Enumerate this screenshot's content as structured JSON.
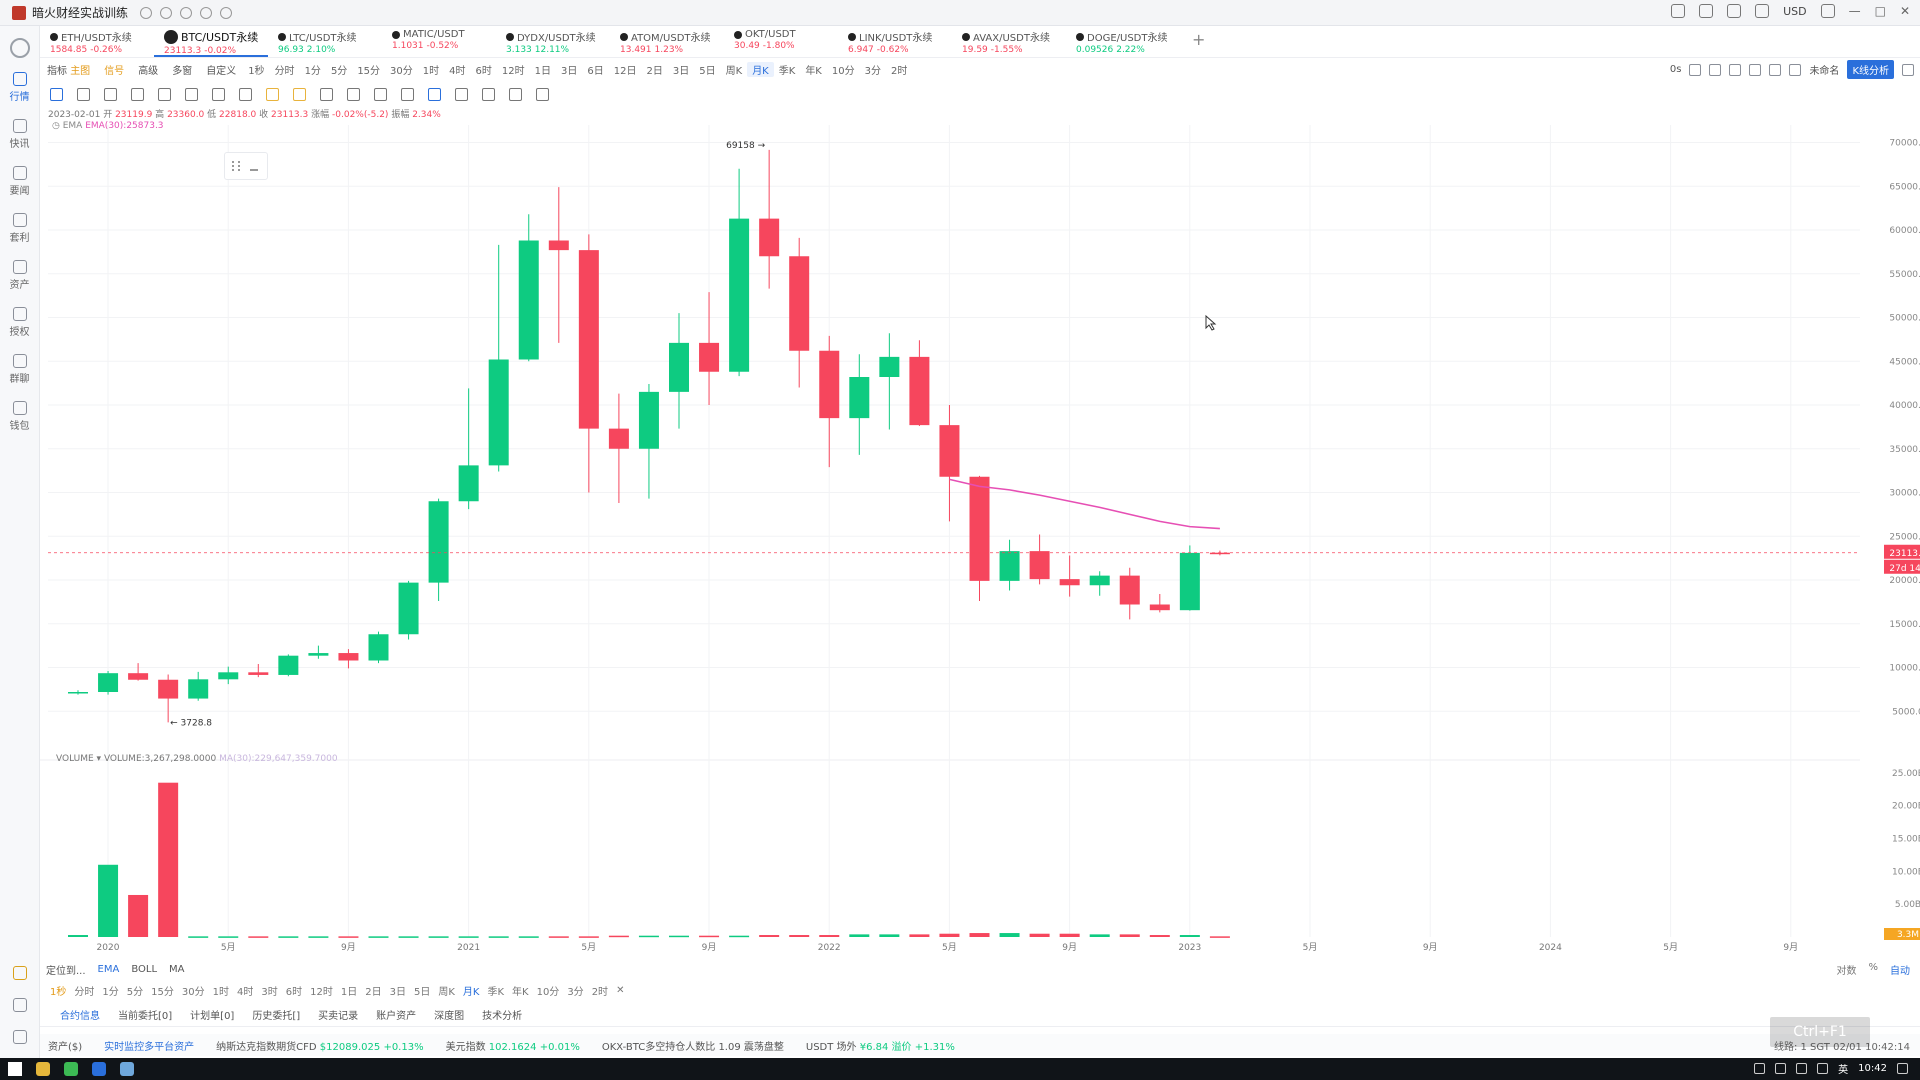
{
  "window": {
    "title": "暗火财经实战训练",
    "currency": "USD"
  },
  "sidebar": {
    "items": [
      {
        "label": "行情",
        "active": true,
        "icon": "market-icon"
      },
      {
        "label": "快讯",
        "active": false,
        "icon": "news-flash-icon"
      },
      {
        "label": "要闻",
        "active": false,
        "icon": "news-icon"
      },
      {
        "label": "套利",
        "active": false,
        "icon": "arbitrage-icon"
      },
      {
        "label": "资产",
        "active": false,
        "icon": "assets-icon"
      },
      {
        "label": "授权",
        "active": false,
        "icon": "auth-icon"
      },
      {
        "label": "群聊",
        "active": false,
        "icon": "chat-icon"
      },
      {
        "label": "钱包",
        "active": false,
        "icon": "wallet-icon"
      }
    ]
  },
  "tabs": [
    {
      "name": "ETH/USDT永续",
      "price": "1584.85",
      "change": "-0.26%",
      "dir": "down"
    },
    {
      "name": "BTC/USDT永续",
      "price": "23113.3",
      "change": "-0.02%",
      "dir": "down",
      "active": true
    },
    {
      "name": "LTC/USDT永续",
      "price": "96.93",
      "change": "2.10%",
      "dir": "up"
    },
    {
      "name": "MATIC/USDT",
      "price": "1.1031",
      "change": "-0.52%",
      "dir": "down"
    },
    {
      "name": "DYDX/USDT永续",
      "price": "3.133",
      "change": "12.11%",
      "dir": "up"
    },
    {
      "name": "ATOM/USDT永续",
      "price": "13.491",
      "change": "1.23%",
      "dir": "down"
    },
    {
      "name": "OKT/USDT",
      "price": "30.49",
      "change": "-1.80%",
      "dir": "down"
    },
    {
      "name": "LINK/USDT永续",
      "price": "6.947",
      "change": "-0.62%",
      "dir": "down"
    },
    {
      "name": "AVAX/USDT永续",
      "price": "19.59",
      "change": "-1.55%",
      "dir": "down"
    },
    {
      "name": "DOGE/USDT永续",
      "price": "0.09526",
      "change": "2.22%",
      "dir": "up"
    }
  ],
  "toolbar": {
    "indicator": "指标",
    "indicator_tag": "主图",
    "signal": "信号",
    "advanced": "高级",
    "multi": "多窗",
    "custom": "自定义",
    "timeframes": [
      "1秒",
      "分时",
      "1分",
      "5分",
      "15分",
      "30分",
      "1时",
      "4时",
      "6时",
      "12时",
      "1日",
      "3日",
      "6日",
      "12日",
      "2日",
      "3日",
      "5日",
      "周K",
      "月K",
      "季K",
      "年K",
      "10分",
      "3分",
      "2时"
    ],
    "selected_tf": "月K",
    "right_seconds": "0s",
    "user": "未命名",
    "kline_btn": "K线分析"
  },
  "ohlc": {
    "date": "2023-02-01",
    "open_l": "开",
    "open": "23119.9",
    "high_l": "高",
    "high": "23360.0",
    "low_l": "低",
    "low": "22818.0",
    "close_l": "收",
    "close": "23113.3",
    "chg_l": "涨幅",
    "chg": "-0.02%(-5.2)",
    "amp_l": "振幅",
    "amp": "2.34%"
  },
  "ema_legend": {
    "label": "EMA",
    "value": "EMA(30):25873.3"
  },
  "volume_header": {
    "label": "VOLUME",
    "value": "VOLUME:3,267,298.0000",
    "ma": "MA(30):229,647,359.7000"
  },
  "chart_data": {
    "type": "candlestick",
    "interval": "1M",
    "months": [
      "2019-12",
      "2020-01",
      "2020-02",
      "2020-03",
      "2020-04",
      "2020-05",
      "2020-06",
      "2020-07",
      "2020-08",
      "2020-09",
      "2020-10",
      "2020-11",
      "2020-12",
      "2021-01",
      "2021-02",
      "2021-03",
      "2021-04",
      "2021-05",
      "2021-06",
      "2021-07",
      "2021-08",
      "2021-09",
      "2021-10",
      "2021-11",
      "2021-12",
      "2022-01",
      "2022-02",
      "2022-03",
      "2022-04",
      "2022-05",
      "2022-06",
      "2022-07",
      "2022-08",
      "2022-09",
      "2022-10",
      "2022-11",
      "2022-12",
      "2023-01",
      "2023-02"
    ],
    "candles": [
      {
        "o": 7200,
        "h": 7400,
        "l": 6900,
        "c": 7200
      },
      {
        "o": 7200,
        "h": 9600,
        "l": 6900,
        "c": 9350
      },
      {
        "o": 9350,
        "h": 10500,
        "l": 8500,
        "c": 8600
      },
      {
        "o": 8600,
        "h": 9200,
        "l": 3728.8,
        "c": 6450
      },
      {
        "o": 6450,
        "h": 9500,
        "l": 6200,
        "c": 8650
      },
      {
        "o": 8650,
        "h": 10100,
        "l": 8100,
        "c": 9450
      },
      {
        "o": 9450,
        "h": 10400,
        "l": 8900,
        "c": 9150
      },
      {
        "o": 9150,
        "h": 11500,
        "l": 9000,
        "c": 11350
      },
      {
        "o": 11350,
        "h": 12500,
        "l": 11000,
        "c": 11650
      },
      {
        "o": 11650,
        "h": 12100,
        "l": 9900,
        "c": 10800
      },
      {
        "o": 10800,
        "h": 14100,
        "l": 10500,
        "c": 13800
      },
      {
        "o": 13800,
        "h": 19900,
        "l": 13200,
        "c": 19700
      },
      {
        "o": 19700,
        "h": 29300,
        "l": 17600,
        "c": 29000
      },
      {
        "o": 29000,
        "h": 41900,
        "l": 28100,
        "c": 33100
      },
      {
        "o": 33100,
        "h": 58300,
        "l": 32400,
        "c": 45200
      },
      {
        "o": 45200,
        "h": 61800,
        "l": 45000,
        "c": 58800
      },
      {
        "o": 58800,
        "h": 64900,
        "l": 47100,
        "c": 57700
      },
      {
        "o": 57700,
        "h": 59500,
        "l": 30000,
        "c": 37300
      },
      {
        "o": 37300,
        "h": 41300,
        "l": 28800,
        "c": 35000
      },
      {
        "o": 35000,
        "h": 42400,
        "l": 29300,
        "c": 41500
      },
      {
        "o": 41500,
        "h": 50500,
        "l": 37300,
        "c": 47100
      },
      {
        "o": 47100,
        "h": 52900,
        "l": 40000,
        "c": 43800
      },
      {
        "o": 43800,
        "h": 67000,
        "l": 43300,
        "c": 61300
      },
      {
        "o": 61300,
        "h": 69158,
        "l": 53300,
        "c": 57000
      },
      {
        "o": 57000,
        "h": 59100,
        "l": 42000,
        "c": 46200
      },
      {
        "o": 46200,
        "h": 47900,
        "l": 32900,
        "c": 38500
      },
      {
        "o": 38500,
        "h": 45800,
        "l": 34300,
        "c": 43200
      },
      {
        "o": 43200,
        "h": 48200,
        "l": 37200,
        "c": 45500
      },
      {
        "o": 45500,
        "h": 47400,
        "l": 37600,
        "c": 37700
      },
      {
        "o": 37700,
        "h": 40000,
        "l": 26700,
        "c": 31800
      },
      {
        "o": 31800,
        "h": 31900,
        "l": 17600,
        "c": 19900
      },
      {
        "o": 19900,
        "h": 24600,
        "l": 18800,
        "c": 23300
      },
      {
        "o": 23300,
        "h": 25200,
        "l": 19500,
        "c": 20100
      },
      {
        "o": 20100,
        "h": 22800,
        "l": 18100,
        "c": 19400
      },
      {
        "o": 19400,
        "h": 21000,
        "l": 18200,
        "c": 20500
      },
      {
        "o": 20500,
        "h": 21400,
        "l": 15500,
        "c": 17200
      },
      {
        "o": 17200,
        "h": 18400,
        "l": 16300,
        "c": 16550
      },
      {
        "o": 16550,
        "h": 23950,
        "l": 16500,
        "c": 23100
      },
      {
        "o": 23119.9,
        "h": 23360,
        "l": 22818,
        "c": 23113.3
      }
    ],
    "volumes_B": [
      0.3,
      11,
      6.4,
      23.5,
      0.1,
      0.1,
      0.1,
      0.1,
      0.1,
      0.1,
      0.1,
      0.1,
      0.1,
      0.1,
      0.1,
      0.1,
      0.1,
      0.1,
      0.2,
      0.2,
      0.2,
      0.2,
      0.2,
      0.3,
      0.3,
      0.3,
      0.4,
      0.4,
      0.4,
      0.5,
      0.6,
      0.6,
      0.5,
      0.5,
      0.4,
      0.4,
      0.3,
      0.3,
      0.1
    ],
    "ema30": [
      {
        "month": "2022-05",
        "value": 31500
      },
      {
        "month": "2022-06",
        "value": 30700
      },
      {
        "month": "2022-07",
        "value": 30300
      },
      {
        "month": "2022-08",
        "value": 29700
      },
      {
        "month": "2022-09",
        "value": 29000
      },
      {
        "month": "2022-10",
        "value": 28300
      },
      {
        "month": "2022-11",
        "value": 27500
      },
      {
        "month": "2022-12",
        "value": 26700
      },
      {
        "month": "2023-01",
        "value": 26100
      },
      {
        "month": "2023-02",
        "value": 25873.3
      }
    ],
    "price_axis": [
      "70000.0",
      "65000.0",
      "60000.0",
      "55000.0",
      "50000.0",
      "45000.0",
      "40000.0",
      "35000.0",
      "30000.0",
      "25000.0",
      "20000.0",
      "15000.0",
      "10000.0",
      "5000.0"
    ],
    "volume_axis": [
      "25.00B",
      "20.00B",
      "15.00B",
      "10.00B",
      "5.00B"
    ],
    "time_axis": [
      "2020",
      "5月",
      "9月",
      "2021",
      "5月",
      "9月",
      "2022",
      "5月",
      "9月",
      "2023",
      "5月",
      "9月",
      "2024",
      "5月",
      "9月"
    ],
    "high_label": "69158",
    "low_label": "3728.8",
    "last_price": "23113.3",
    "countdown": "27d 14h",
    "volume_last_badge": "3.3M",
    "colors": {
      "up": "#0ecb81",
      "down": "#f6465d",
      "ema": "#e64fb4",
      "grid": "#f2f3f5"
    },
    "ylim": [
      0,
      72000
    ]
  },
  "bottom_bar": {
    "locate": "定位到...",
    "ema": "EMA",
    "boll": "BOLL",
    "ma": "MA",
    "log": "对数",
    "pct": "%",
    "auto": "自动"
  },
  "tf_bar": [
    "1秒",
    "分时",
    "1分",
    "5分",
    "15分",
    "30分",
    "1时",
    "4时",
    "3时",
    "6时",
    "12时",
    "1日",
    "2日",
    "3日",
    "5日",
    "周K",
    "月K",
    "季K",
    "年K",
    "10分",
    "3分",
    "2时"
  ],
  "tf_bar_selected": "月K",
  "order_tabs": [
    "合约信息",
    "当前委托[0]",
    "计划单[0]",
    "历史委托[]",
    "买卖记录",
    "账户资产",
    "深度图",
    "技术分析"
  ],
  "ticker_bar": {
    "assets": "资产($)",
    "monitor": "实时监控多平台资产",
    "nasdaq_label": "纳斯达克指数期货CFD",
    "nasdaq": "$12089.025",
    "nasdaq_chg": "+0.13%",
    "dxy_label": "美元指数",
    "dxy": "102.1624",
    "dxy_chg": "+0.01%",
    "okx_label": "OKX-BTC多空持仓人数比",
    "okx": "1.09",
    "okx_state": "震荡盘整",
    "usdt_label": "USDT 场外",
    "usdt": "¥6.84",
    "usdt_prem": "溢价 +1.31%",
    "right": "线路: 1  SGT 02/01 10:42:14"
  },
  "watermark": "Ctrl+F1",
  "taskbar": {
    "ime": "英",
    "time": "10:42"
  }
}
